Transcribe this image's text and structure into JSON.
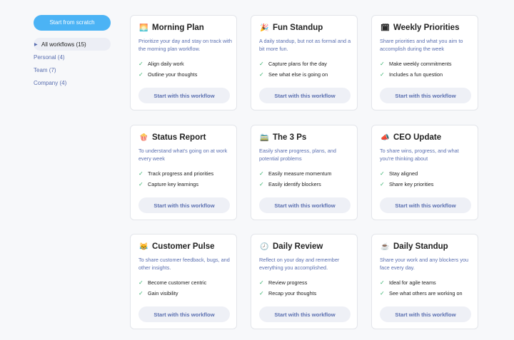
{
  "sidebar": {
    "scratch_label": "Start from scratch",
    "items": [
      {
        "label": "All workflows (15)"
      },
      {
        "label": "Personal (4)"
      },
      {
        "label": "Team (7)"
      },
      {
        "label": "Company (4)"
      }
    ]
  },
  "cards": [
    {
      "emoji": "🌅",
      "title": "Morning Plan",
      "desc": "Prioritize your day and stay on track with the morning plan workflow.",
      "features": [
        "Align daily work",
        "Outline your thoughts"
      ],
      "button": "Start with this workflow"
    },
    {
      "emoji": "🎉",
      "title": "Fun Standup",
      "desc": "A daily standup, but not as formal and a bit more fun.",
      "features": [
        "Capture plans for the day",
        "See what else is going on"
      ],
      "button": "Start with this workflow"
    },
    {
      "emoji": "🗓",
      "title": "Weekly Priorities",
      "desc": "Share priorities and what you aim to accomplish during the week",
      "features": [
        "Make weekly commitments",
        "Includes a fun question"
      ],
      "button": "Start with this workflow"
    },
    {
      "emoji": "🍿",
      "title": "Status Report",
      "desc": "To understand what's going on at work every week",
      "features": [
        "Track progress and priorities",
        "Capture key learnings"
      ],
      "button": "Start with this workflow"
    },
    {
      "emoji": "🚞",
      "title": "The 3 Ps",
      "desc": "Easily share progress, plans, and potential problems",
      "features": [
        "Easily measure momentum",
        "Easily identify blockers"
      ],
      "button": "Start with this workflow"
    },
    {
      "emoji": "📣",
      "title": "CEO Update",
      "desc": "To share wins, progress, and what you're thinking about",
      "features": [
        "Stay aligned",
        "Share key priorities"
      ],
      "button": "Start with this workflow"
    },
    {
      "emoji": "😹",
      "title": "Customer Pulse",
      "desc": "To share customer feedback, bugs, and other insights.",
      "features": [
        "Become customer centric",
        "Gain visibility"
      ],
      "button": "Start with this workflow"
    },
    {
      "emoji": "🕗",
      "title": "Daily Review",
      "desc": "Reflect on your day and remember everything you accomplished.",
      "features": [
        "Review progress",
        "Recap your thoughts"
      ],
      "button": "Start with this workflow"
    },
    {
      "emoji": "☕",
      "title": "Daily Standup",
      "desc": "Share your work and any blockers you face every day.",
      "features": [
        "Ideal for agile teams",
        "See what others are working on"
      ],
      "button": "Start with this workflow"
    }
  ]
}
